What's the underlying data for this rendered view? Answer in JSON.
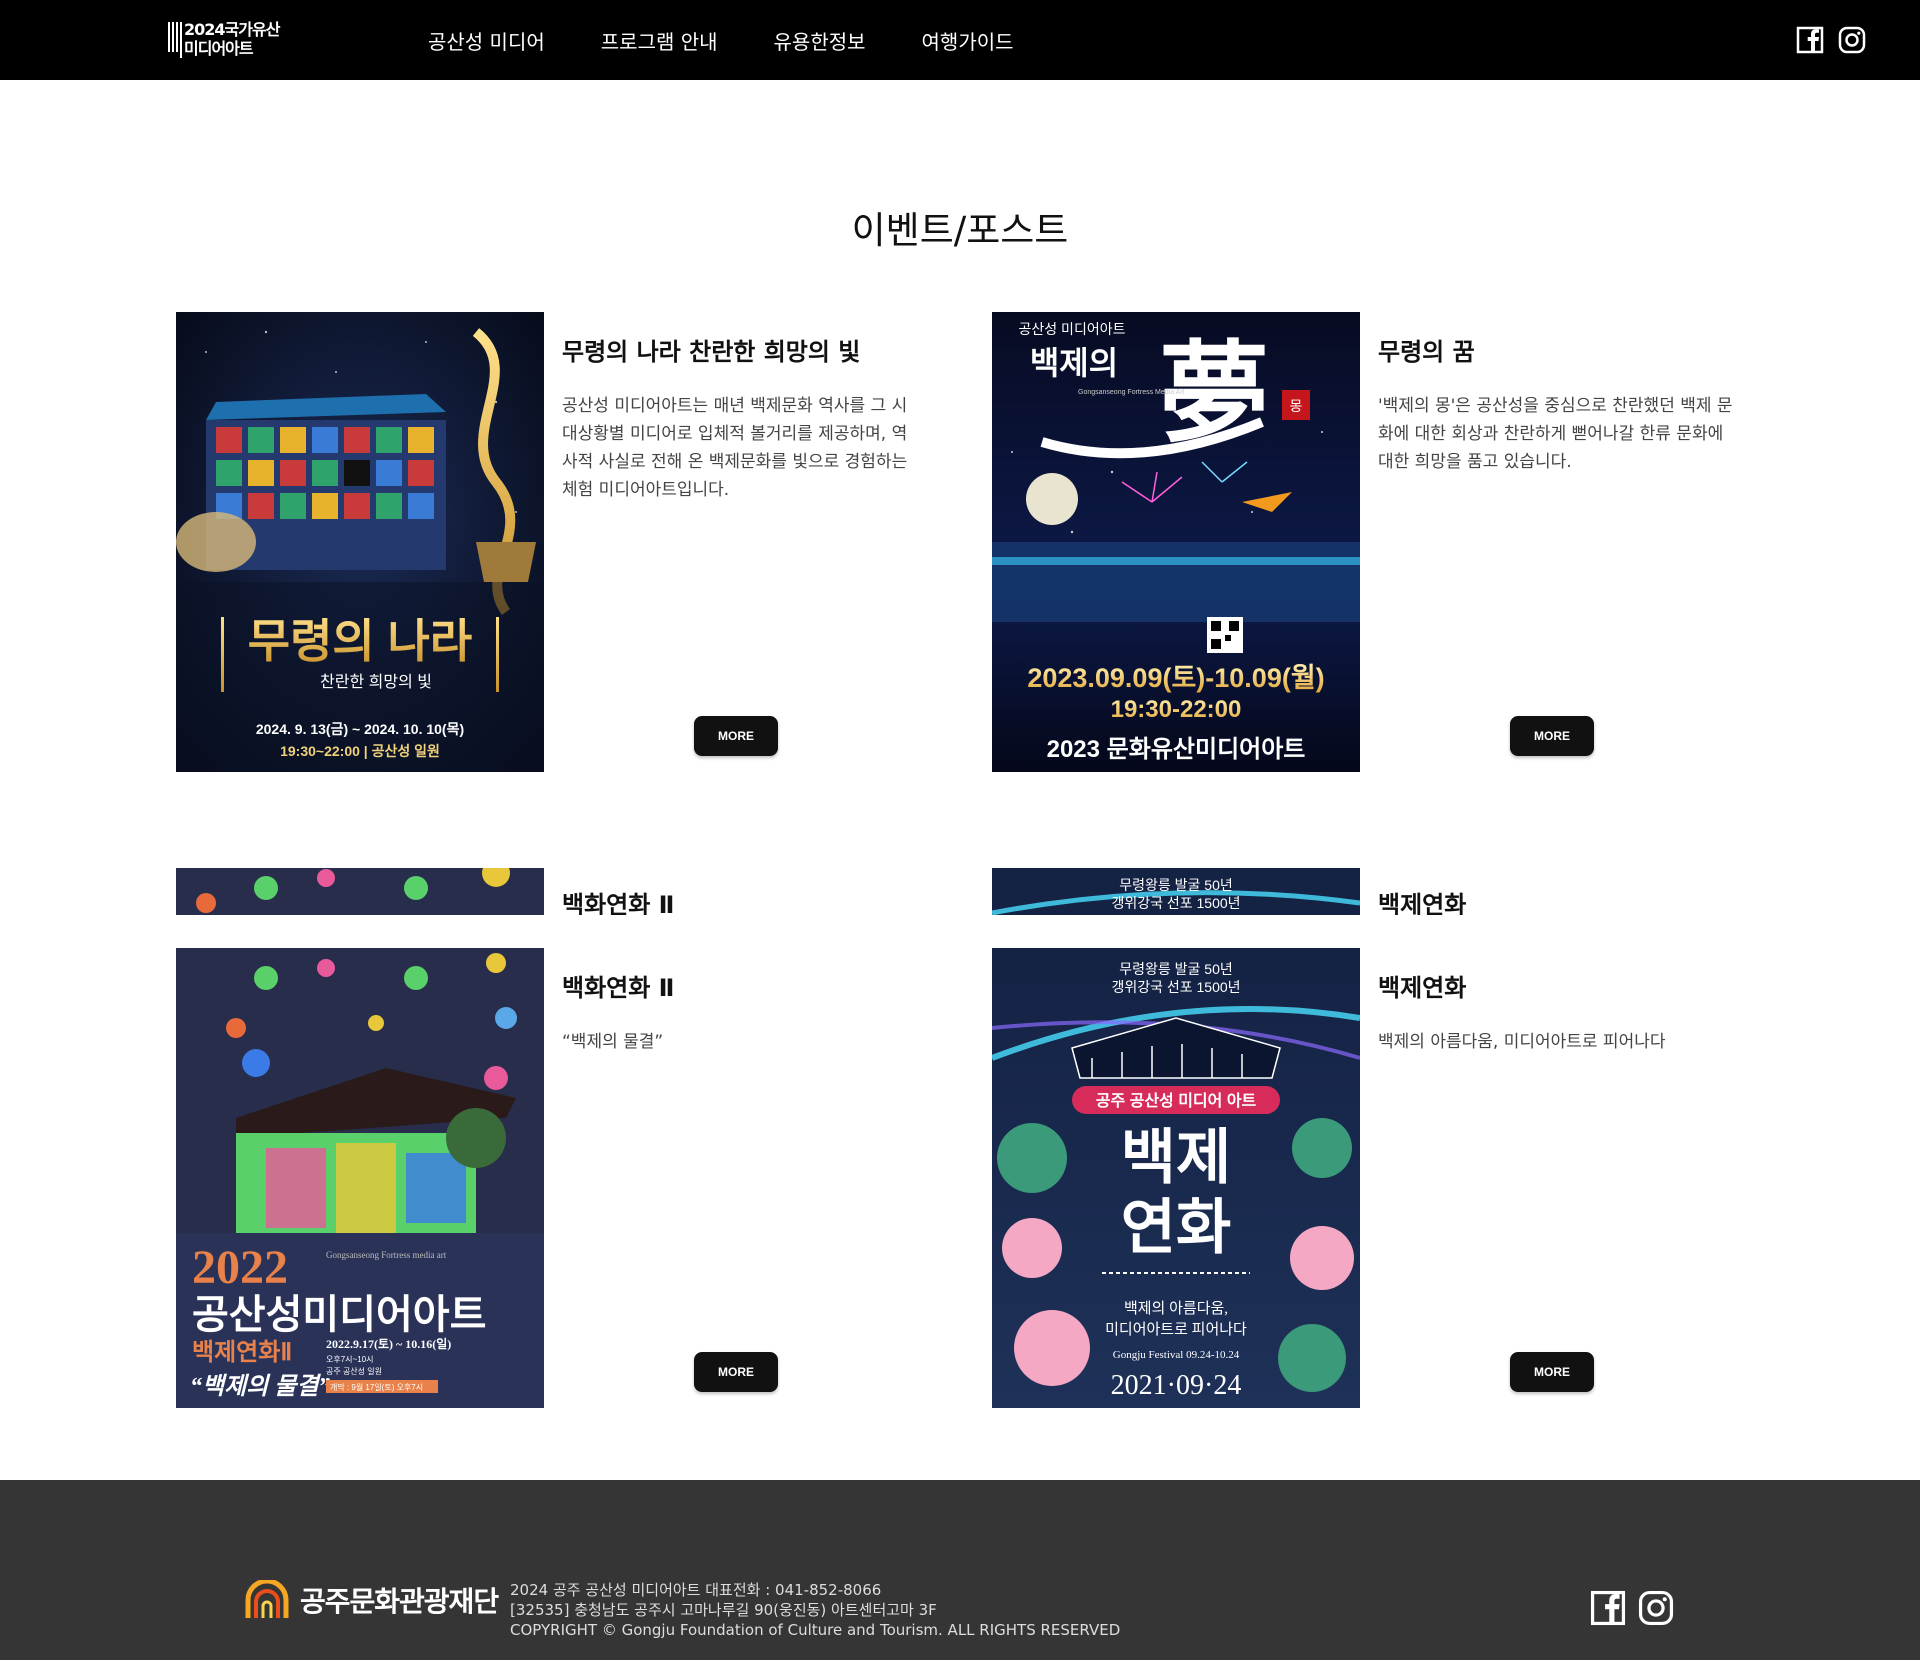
{
  "header": {
    "logo_line1": "2024국가유산",
    "logo_line2": "미디어아트",
    "nav": [
      "공산성 미디어",
      "프로그램 안내",
      "유용한정보",
      "여행가이드"
    ],
    "social_icons": [
      "facebook-icon",
      "instagram-icon"
    ]
  },
  "page_title": "이벤트/포스트",
  "cards": [
    {
      "title": "무령의 나라 찬란한 희망의 빛",
      "description": "공산성 미디어아트는 매년 백제문화 역사를 그 시대상황별 미디어로 입체적 볼거리를 제공하며, 역사적 사실로 전해 온 백제문화를 빛으로 경험하는 체험 미디어아트입니다.",
      "more": "MORE",
      "poster": {
        "title": "무령의 나라",
        "subtitle": "찬란한  희망의 빛",
        "dates": "2024. 9. 13(금) ~ 2024. 10. 10(목)",
        "time": "19:30~22:00  |  공산성 일원"
      }
    },
    {
      "title": "무령의 꿈",
      "description": "'백제의 몽'은 공산성을 중심으로 찬란했던 백제 문화에 대한 회상과 찬란하게 뻗어나갈 한류 문화에 대한 희망을 품고 있습니다.",
      "more": "MORE",
      "poster": {
        "top": "공산성 미디어아트",
        "script": "백제의",
        "big": "夢",
        "seal": "몽",
        "en": "Gongsanseong Fortress Media Art",
        "dates": "2023.09.09(토)-10.09(월)",
        "time": "19:30-22:00",
        "bottom": "2023 문화유산미디어아트"
      }
    },
    {
      "title": "백화연화 Ⅱ",
      "description": "“백제의 물결”",
      "more": "MORE",
      "poster": {
        "year": "2022",
        "en": "Gongsanseong Fortress media art",
        "title": "공산성미디어아트",
        "sub": "백제연화Ⅱ",
        "dates": "2022.9.17(토) ~ 10.16(일)",
        "time": "오후7시~10시",
        "place": "공주 공산성 일원",
        "slogan": "“백제의 물결”",
        "tag": "개막 : 9월 17일(토) 오후7시"
      }
    },
    {
      "title": "백제연화",
      "description": "백제의 아름다움, 미디어아트로 피어나다",
      "more": "MORE",
      "poster": {
        "top1": "무령왕릉 발굴 50년",
        "top2": "갱위강국 선포 1500년",
        "badge": "공주 공산성 미디어 아트",
        "title1": "백제",
        "title2": "연화",
        "sub1": "백제의 아름다움,",
        "sub2": "미디어아트로 피어나다",
        "fest": "Gongju Festival 09.24-10.24",
        "date": "2021·09·24"
      }
    }
  ],
  "footer": {
    "org": "공주문화관광재단",
    "line1": "2024 공주 공산성 미디어아트 대표전화 : 041-852-8066",
    "line2": "[32535] 충청남도 공주시 고마나루길 90(웅진동) 아트센터고마 3F",
    "line3": "COPYRIGHT © Gongju Foundation of Culture and Tourism. ALL RIGHTS RESERVED"
  }
}
